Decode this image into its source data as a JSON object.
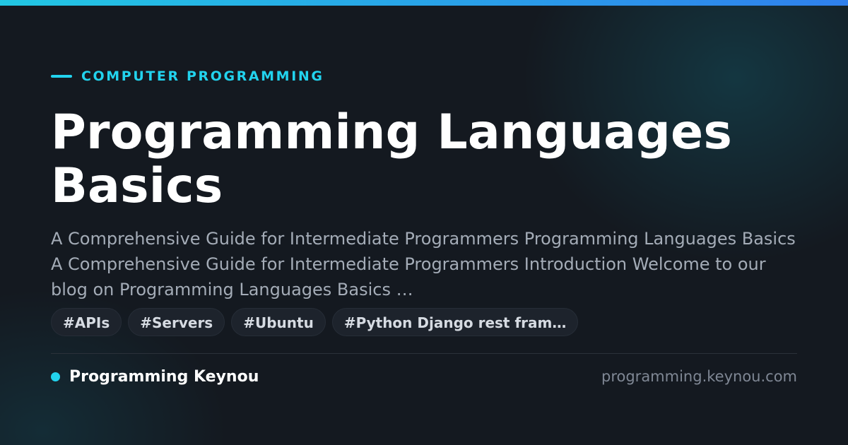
{
  "category": "COMPUTER PROGRAMMING",
  "title": "Programming Languages Basics",
  "description": "A Comprehensive Guide for Intermediate Programmers Programming Languages Basics A Comprehensive Guide for Intermediate Programmers Introduction Welcome to our blog on Programming Languages Basics …",
  "tags": [
    {
      "label": "#APIs"
    },
    {
      "label": "#Servers"
    },
    {
      "label": "#Ubuntu"
    },
    {
      "label": "#Python Django rest fram…"
    }
  ],
  "footer": {
    "brand": "Programming Keynou",
    "url": "programming.keynou.com"
  },
  "colors": {
    "accent": "#22d3ee",
    "background": "#141920",
    "title": "#ffffff",
    "description": "#a4acb7",
    "url": "#7f8794"
  }
}
